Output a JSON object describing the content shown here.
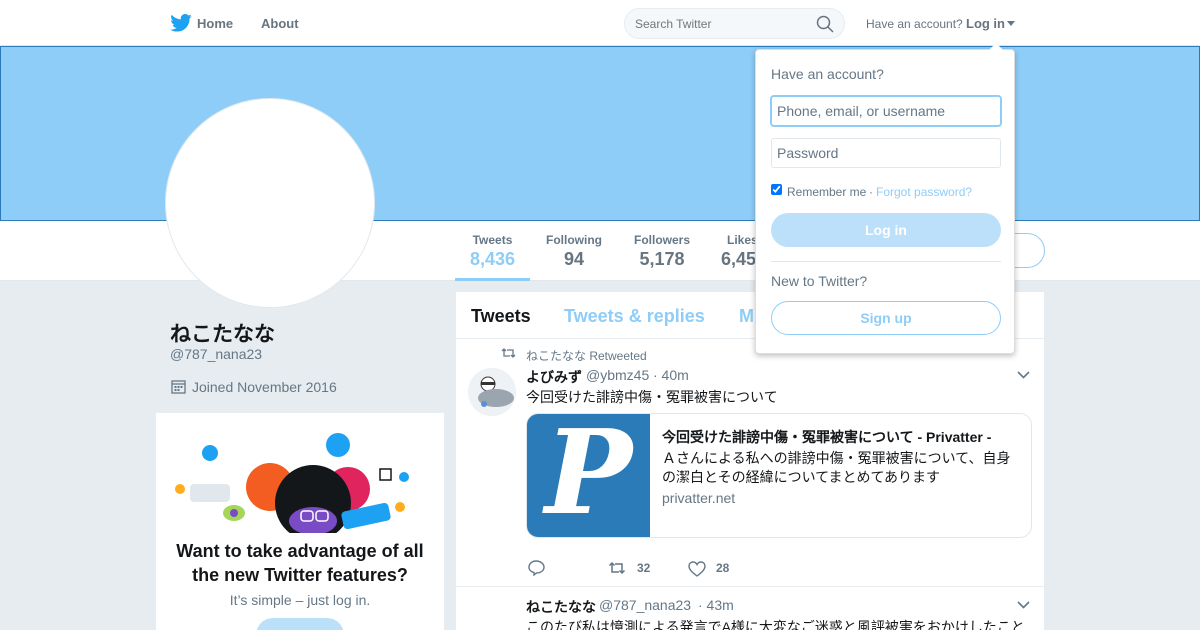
{
  "nav": {
    "home_label": "Home",
    "about_label": "About",
    "search_placeholder": "Search Twitter",
    "have_account": "Have an account?",
    "login_label": "Log in"
  },
  "profile": {
    "name": "ねこたなな",
    "handle": "@787_nana23",
    "joined": "Joined November 2016"
  },
  "stats": [
    {
      "label": "Tweets",
      "value": "8,436"
    },
    {
      "label": "Following",
      "value": "94"
    },
    {
      "label": "Followers",
      "value": "5,178"
    },
    {
      "label": "Likes",
      "value": "6,45"
    }
  ],
  "tabs": [
    "Tweets",
    "Tweets & replies",
    "M"
  ],
  "tweets": [
    {
      "retweet_context": "ねこたなな Retweeted",
      "name": "よびみず",
      "handle": "@ybmz45",
      "time": "· 40m",
      "text": "今回受けた誹謗中傷・冤罪被害について",
      "card": {
        "title": "今回受けた誹謗中傷・冤罪被害について - Privatter -",
        "description": "Ａさんによる私への誹謗中傷・冤罪被害について、自身の潔白とその経緯についてまとめてあります",
        "domain": "privatter.net",
        "logo_letter": "P"
      },
      "retweets": "32",
      "likes": "28"
    },
    {
      "name": "ねこたなな",
      "handle": "@787_nana23",
      "time": "· 43m",
      "text": "このたび私は憶測による発言でA様に大変なご迷惑と風評被害をおかけしたこと"
    }
  ],
  "promo": {
    "headline": "Want to take advantage of all the new Twitter features?",
    "sub": "It’s simple – just log in."
  },
  "login_dropdown": {
    "title": "Have an account?",
    "username_placeholder": "Phone, email, or username",
    "password_placeholder": "Password",
    "remember_me": "Remember me",
    "separator": "·",
    "forgot": "Forgot password?",
    "login_button": "Log in",
    "new_to": "New to Twitter?",
    "signup_button": "Sign up"
  },
  "colors": {
    "brand": "#1da1f2",
    "banner": "#8ecdf8",
    "button_light": "#bce0fa"
  }
}
